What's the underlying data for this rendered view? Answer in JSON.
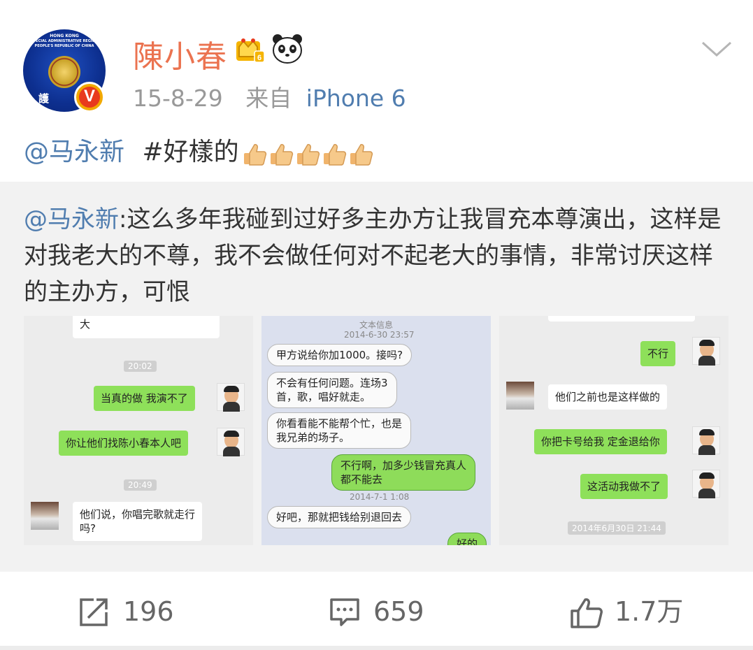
{
  "post": {
    "avatar_caption": "HONG KONG",
    "avatar_caption2": "SPECIAL ADMINISTRATIVE REGION",
    "avatar_caption3": "PEOPLE'S REPUBLIC OF CHINA",
    "avatar_char": "護",
    "verified_badge": "V",
    "username": "陳小春",
    "time": "15-8-29",
    "source_prefix": "来自",
    "device": "iPhone 6",
    "mention": "@马永新",
    "topic": "#好樣的",
    "thumbs_count": 5,
    "icons": {
      "crown": "crown-vip-icon",
      "panda": "panda-icon",
      "menu": "chevron-down-icon",
      "thumb": "thumbs-up-emoji"
    }
  },
  "repost": {
    "mention": "@马永新",
    "text": ":这么多年我碰到过好多主办方让我冒充本尊演出，这样是对我老大的不尊，我不会做任何对不起老大的事情，非常讨厌这样的主办方，可恨",
    "image1": {
      "top_fragment": "大",
      "chip1": "20:02",
      "msg1": "当真的做 我演不了",
      "msg2": "你让他们找陈小春本人吧",
      "chip2": "20:49",
      "msg3_line1": "他们说，你唱完歌就走行",
      "msg3_line2": "吗?"
    },
    "image2": {
      "header": "文本信息",
      "date1": "2014-6-30 23:57",
      "msg1": "甲方说给你加1000。接吗?",
      "msg2_line1": "不会有任何问题。连场3",
      "msg2_line2": "首，歌，唱好就走。",
      "msg3_line1": "你看看能不能帮个忙，也是",
      "msg3_line2": "我兄弟的场子。",
      "msg4_line1": "不行啊，加多少钱冒充真人",
      "msg4_line2": "都不能去",
      "date2": "2014-7-1 1:08",
      "msg5": "好吧，那就把钱给别退回去",
      "msg6": "好的"
    },
    "image3": {
      "msg1": "不行",
      "msg2": "他们之前也是这样做的",
      "msg3": "你把卡号给我 定金退给你",
      "msg4": "这活动我做不了",
      "chip": "2014年6月30日 21:44"
    }
  },
  "actions": {
    "repost": {
      "icon": "repost-icon",
      "count": "196"
    },
    "comment": {
      "icon": "comment-icon",
      "count": "659"
    },
    "like": {
      "icon": "like-icon",
      "count": "1.7万"
    }
  },
  "colors": {
    "username": "#eb7350",
    "link": "#507daf",
    "meta": "#999999",
    "repost_bg": "#f2f2f2"
  }
}
